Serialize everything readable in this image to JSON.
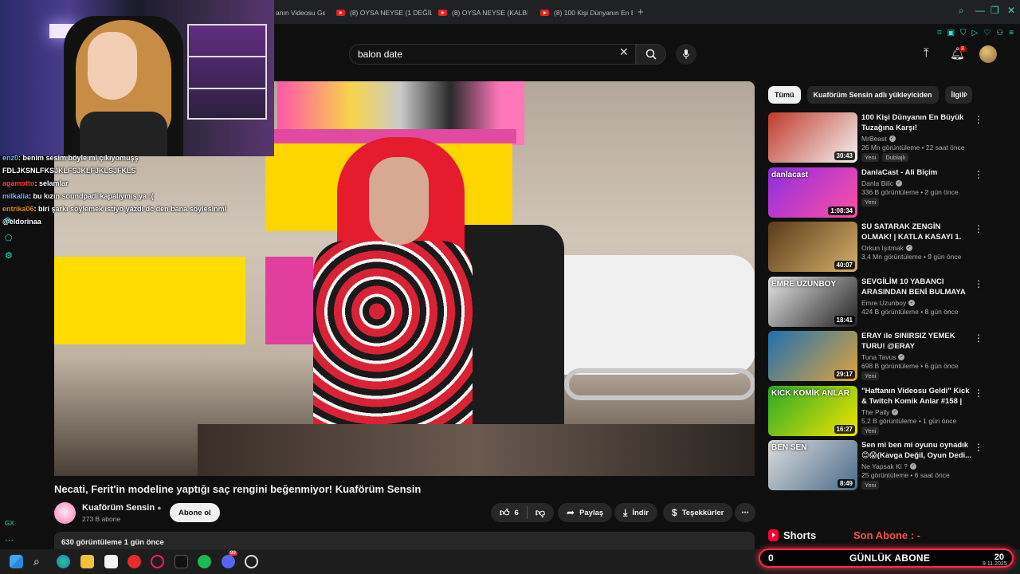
{
  "browser": {
    "tabs": [
      {
        "label": "anın Videosu Ge"
      },
      {
        "label": "(8) OYSA NEYSE (1 DEĞİL"
      },
      {
        "label": "(8) OYSA NEYSE (KALBİN"
      },
      {
        "label": "(8) 100 Kişi Dünyanın En B"
      }
    ],
    "new_tab": "+"
  },
  "search": {
    "value": "balon date"
  },
  "header": {
    "notifications": "8"
  },
  "chat": {
    "lines": [
      {
        "user": "enz0",
        "msg": ": benim sesim böyle mi çıkıyomuşş"
      },
      {
        "user": "",
        "msg": "FDLJKSNLFKSJKLFSJKLFJKLSJFKLS"
      },
      {
        "user": "agamotto",
        "msg": ": selamlar"
      },
      {
        "user": "milkalia",
        "msg": ": bu kızın soundpadi kapalıymış ya :("
      },
      {
        "user": "entrika06",
        "msg": ": biri şarkı söylemek istiyo yazdı dc den bana söylesinmi"
      },
      {
        "user": "",
        "msg": "@eldorinaa"
      }
    ]
  },
  "streamer": {
    "gx_label": "GX"
  },
  "video": {
    "title": "Necati, Ferit'in modeline yaptığı saç rengini beğenmiyor! Kuaförüm Sensin",
    "channel": "Kuaförüm Sensin",
    "subscribers": "273 B abone",
    "subscribe_label": "Abone ol",
    "likes": "6",
    "share_label": "Paylaş",
    "download_label": "İndir",
    "thanks_label": "Teşekkürler",
    "views_date": "630 görüntüleme  1 gün önce"
  },
  "chips": [
    {
      "label": "Tümü",
      "active": true
    },
    {
      "label": "Kuaförüm Sensin adlı yükleyiciden",
      "active": false
    },
    {
      "label": "İlgili",
      "active": false
    }
  ],
  "recommendations": [
    {
      "title": "100 Kişi Dünyanın En Büyük Tuzağına Karşı!",
      "channel": "MrBeast",
      "views": "26 Mn görüntüleme • 22 saat önce",
      "badges": [
        "Yeni",
        "Dublajlı"
      ],
      "duration": "30:43",
      "thumb_text": "",
      "thumb_colors": "#c0392b,#f4f4f4"
    },
    {
      "title": "DanlaCast - Ali Biçim",
      "channel": "Danla Bilic",
      "views": "336 B görüntüleme • 2 gün önce",
      "badges": [
        "Yeni"
      ],
      "duration": "1:08:34",
      "thumb_text": "danlacast",
      "thumb_colors": "#8e2de2,#ff4fa3"
    },
    {
      "title": "SU SATARAK ZENGİN OLMAK! | KATLA KASAYI 1. BÖLÜM ...",
      "channel": "Orkun Işıtmak",
      "views": "3,4 Mn görüntüleme • 9 gün önce",
      "badges": [],
      "duration": "40:07",
      "thumb_text": "",
      "thumb_colors": "#5a3b1a,#d4b06a"
    },
    {
      "title": "SEVGİLİM 10 YABANCI ARASINDAN BENİ BULMAYA ...",
      "channel": "Emre Uzunboy",
      "views": "424 B görüntüleme • 8 gün önce",
      "badges": [],
      "duration": "18:41",
      "thumb_text": "EMRE UZUNBOY",
      "thumb_colors": "#e6e6e6,#222222"
    },
    {
      "title": "ERAY ile SINIRSIZ YEMEK TURU! @ERAY",
      "channel": "Tuna Tavus",
      "views": "698 B görüntüleme • 6 gün önce",
      "badges": [
        "Yeni"
      ],
      "duration": "29:17",
      "thumb_text": "",
      "thumb_colors": "#1f6fb2,#e0a53a"
    },
    {
      "title": "\"Haftanın Videosu Geldi\" Kick & Twitch Komik Anlar #158 | The...",
      "channel": "The Pally",
      "views": "5,2 B görüntüleme • 1 gün önce",
      "badges": [
        "Yeni"
      ],
      "duration": "16:27",
      "thumb_text": "KICK KOMİK ANLAR",
      "thumb_colors": "#2aa82a,#f2e600"
    },
    {
      "title": "Sen mi ben mi oyunu oynadık 😊😱(Kavga Değil, Oyun Dedi...",
      "channel": "Ne Yapsak Ki ?",
      "views": "25 görüntüleme • 6 saat önce",
      "badges": [
        "Yeni"
      ],
      "duration": "8:49",
      "thumb_text": "BEN  SEN",
      "thumb_colors": "#dddddd,#4a6a8a"
    }
  ],
  "shorts": {
    "label": "Shorts"
  },
  "overlay": {
    "son_abone": "Son Abone : -",
    "goal_left": "0",
    "goal_label": "GÜNLÜK ABONE",
    "goal_right": "20"
  },
  "taskbar": {
    "date": "9.11.2025",
    "notif_badge": "99"
  }
}
